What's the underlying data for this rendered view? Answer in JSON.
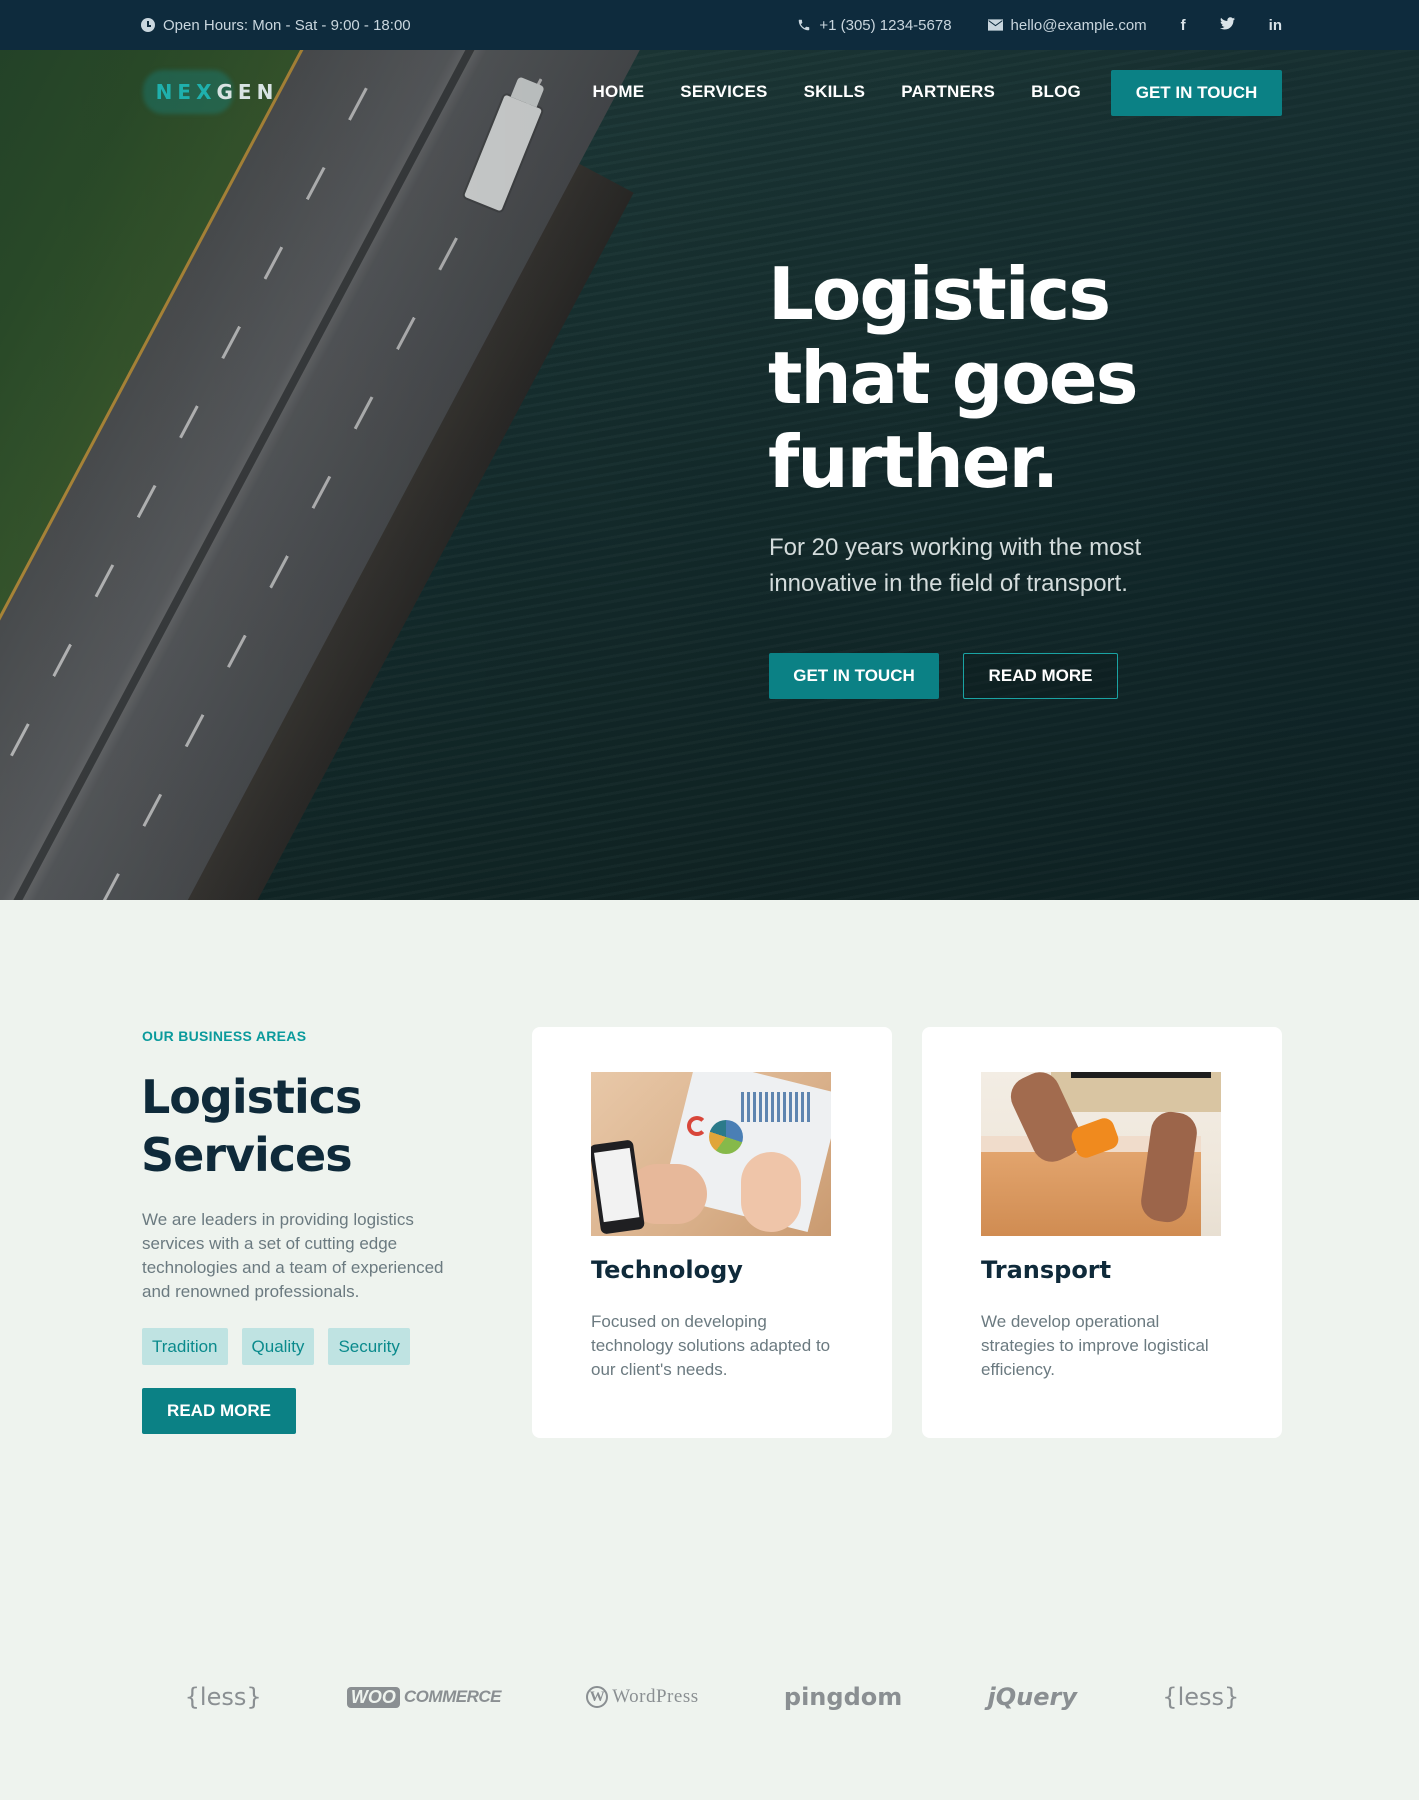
{
  "topbar": {
    "hours": "Open Hours: Mon - Sat - 9:00 - 18:00",
    "phone": "+1 (305) 1234-5678",
    "email": "hello@example.com",
    "social": [
      "f",
      "t",
      "in"
    ]
  },
  "nav": {
    "logo_left": "NEX",
    "logo_right": "GEN",
    "items": [
      "HOME",
      "SERVICES",
      "SKILLS",
      "PARTNERS",
      "BLOG"
    ],
    "cta": "GET IN TOUCH"
  },
  "hero": {
    "title_line1": "Logistics",
    "title_line2": "that goes",
    "title_line3": "further.",
    "subtitle": "For 20 years working with the most innovative in the field of transport.",
    "primary_button": "GET IN TOUCH",
    "secondary_button": "READ MORE"
  },
  "business": {
    "eyebrow": "OUR BUSINESS AREAS",
    "title": "Logistics Services",
    "text": "We are leaders in providing logistics services with a set of cutting edge technologies and a team of experienced and renowned professionals.",
    "tags": [
      "Tradition",
      "Quality",
      "Security"
    ],
    "button": "READ MORE",
    "cards": [
      {
        "title": "Technology",
        "text": "Focused on developing technology solutions adapted to our client's needs."
      },
      {
        "title": "Transport",
        "text": "We develop operational strategies to improve logistical efficiency."
      }
    ]
  },
  "partners": {
    "logos": [
      "{less}",
      "WOO",
      "COMMERCE",
      "W",
      "WordPress",
      "pingdom",
      "jQuery",
      "{less}"
    ]
  },
  "colors": {
    "accent": "#0b8185",
    "dark": "#0e2b3d",
    "background": "#eef3ee"
  }
}
